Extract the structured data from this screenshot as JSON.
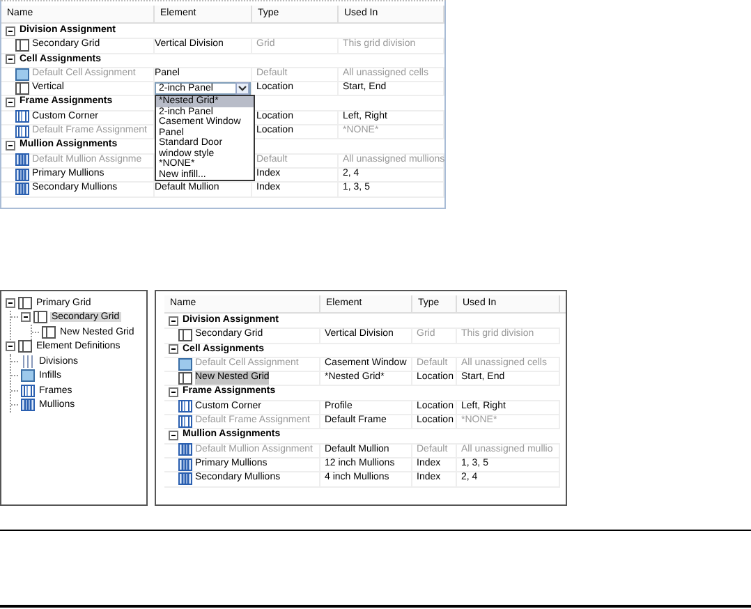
{
  "top_table": {
    "columns": [
      "Name",
      "Element",
      "Type",
      "Used In"
    ],
    "groups": [
      {
        "title": "Division Assignment",
        "expanded": true,
        "rows": [
          {
            "kind": "grid",
            "name": "Secondary Grid",
            "element": "Vertical Division",
            "type": "Grid",
            "used_in": "This grid division",
            "name_dimmed": false,
            "type_dimmed": true,
            "used_in_dimmed": true
          }
        ]
      },
      {
        "title": "Cell Assignments",
        "expanded": true,
        "rows": [
          {
            "kind": "infill",
            "name": "Default Cell Assignment",
            "element": "Panel",
            "type": "Default",
            "used_in": "All unassigned cells",
            "name_dimmed": true,
            "type_dimmed": true,
            "used_in_dimmed": true
          },
          {
            "kind": "grid",
            "name": "Vertical",
            "element": "2-inch Panel",
            "type": "Location",
            "used_in": "Start, End",
            "name_dimmed": false,
            "type_dimmed": false,
            "used_in_dimmed": false,
            "options": [
              {
                "label": "*Nested Grid*",
                "selected": true
              },
              {
                "label": "2-inch Panel",
                "selected": false
              },
              {
                "label": "Casement Window",
                "selected": false
              },
              {
                "label": "Panel",
                "selected": false
              },
              {
                "label": "Standard Door",
                "selected": false
              },
              {
                "label": "window style",
                "selected": false
              },
              {
                "label": "*NONE*",
                "selected": false
              },
              {
                "label": "New infill...",
                "selected": false
              }
            ]
          }
        ]
      },
      {
        "title": "Frame Assignments",
        "expanded": true,
        "rows": [
          {
            "kind": "frame",
            "name": "Custom Corner",
            "type": "Location",
            "used_in": "Left, Right",
            "name_dimmed": false,
            "type_dimmed": false,
            "used_in_dimmed": false
          },
          {
            "kind": "frame",
            "name": "Default Frame Assignment",
            "type": "Location",
            "used_in": "*NONE*",
            "name_dimmed": true,
            "type_dimmed": false,
            "used_in_dimmed": true
          }
        ]
      },
      {
        "title": "Mullion Assignments",
        "expanded": true,
        "rows": [
          {
            "kind": "mullion",
            "name": "Default Mullion Assignme",
            "type": "Default",
            "used_in": "All unassigned mullions",
            "name_dimmed": true,
            "type_dimmed": true,
            "used_in_dimmed": true
          },
          {
            "kind": "mullion",
            "name": "Primary Mullions",
            "type": "Index",
            "used_in": "2, 4",
            "name_dimmed": false,
            "type_dimmed": false,
            "used_in_dimmed": false
          },
          {
            "kind": "mullion",
            "name": "Secondary Mullions",
            "element": "Default Mullion",
            "type": "Index",
            "used_in": "1, 3, 5",
            "name_dimmed": false,
            "type_dimmed": false,
            "used_in_dimmed": false
          }
        ]
      }
    ]
  },
  "tree": [
    {
      "label": "Primary Grid",
      "kind": "grid",
      "selected": false,
      "expanded": true,
      "children": [
        {
          "label": "Secondary Grid",
          "kind": "grid",
          "selected": true,
          "expanded": true,
          "children": [
            {
              "label": "New Nested Grid",
              "kind": "grid",
              "selected": false
            }
          ]
        }
      ]
    },
    {
      "label": "Element Definitions",
      "kind": "grid",
      "selected": false,
      "expanded": true,
      "children": [
        {
          "label": "Divisions",
          "kind": "division",
          "selected": false
        },
        {
          "label": "Infills",
          "kind": "infill",
          "selected": false
        },
        {
          "label": "Frames",
          "kind": "frame",
          "selected": false
        },
        {
          "label": "Mullions",
          "kind": "mullion",
          "selected": false
        }
      ]
    }
  ],
  "bottom_table": {
    "columns": [
      "Name",
      "Element",
      "Type",
      "Used In"
    ],
    "groups": [
      {
        "title": "Division Assignment",
        "expanded": true,
        "rows": [
          {
            "kind": "grid",
            "name": "Secondary Grid",
            "element": "Vertical Division",
            "type": "Grid",
            "used_in": "This grid division",
            "selected": false,
            "name_dimmed": false,
            "type_dimmed": true,
            "used_in_dimmed": true
          }
        ]
      },
      {
        "title": "Cell Assignments",
        "expanded": true,
        "rows": [
          {
            "kind": "infill",
            "name": "Default Cell Assignment",
            "element": "Casement Window",
            "type": "Default",
            "used_in": "All unassigned cells",
            "selected": false,
            "name_dimmed": true,
            "type_dimmed": true,
            "used_in_dimmed": true
          },
          {
            "kind": "grid",
            "name": "New Nested Grid",
            "element": "*Nested Grid*",
            "type": "Location",
            "used_in": "Start, End",
            "selected": true,
            "name_dimmed": false,
            "type_dimmed": false,
            "used_in_dimmed": false
          }
        ]
      },
      {
        "title": "Frame Assignments",
        "expanded": true,
        "rows": [
          {
            "kind": "frame",
            "name": "Custom Corner",
            "element": "Profile",
            "type": "Location",
            "used_in": "Left, Right",
            "selected": false,
            "name_dimmed": false,
            "type_dimmed": false,
            "used_in_dimmed": false
          },
          {
            "kind": "frame",
            "name": "Default Frame Assignment",
            "element": "Default Frame",
            "type": "Location",
            "used_in": "*NONE*",
            "selected": false,
            "name_dimmed": true,
            "type_dimmed": false,
            "used_in_dimmed": true
          }
        ]
      },
      {
        "title": "Mullion Assignments",
        "expanded": true,
        "rows": [
          {
            "kind": "mullion",
            "name": "Default Mullion Assignment",
            "element": "Default Mullion",
            "type": "Default",
            "used_in": "All unassigned mullio",
            "selected": false,
            "name_dimmed": true,
            "type_dimmed": true,
            "used_in_dimmed": true
          },
          {
            "kind": "mullion",
            "name": "Primary Mullions",
            "element": "12 inch Mullions",
            "type": "Index",
            "used_in": "1, 3, 5",
            "selected": false,
            "name_dimmed": false,
            "type_dimmed": false,
            "used_in_dimmed": false
          },
          {
            "kind": "mullion",
            "name": "Secondary Mullions",
            "element": "4 inch Mullions",
            "type": "Index",
            "used_in": "2, 4",
            "selected": false,
            "name_dimmed": false,
            "type_dimmed": false,
            "used_in_dimmed": false
          }
        ]
      }
    ]
  }
}
